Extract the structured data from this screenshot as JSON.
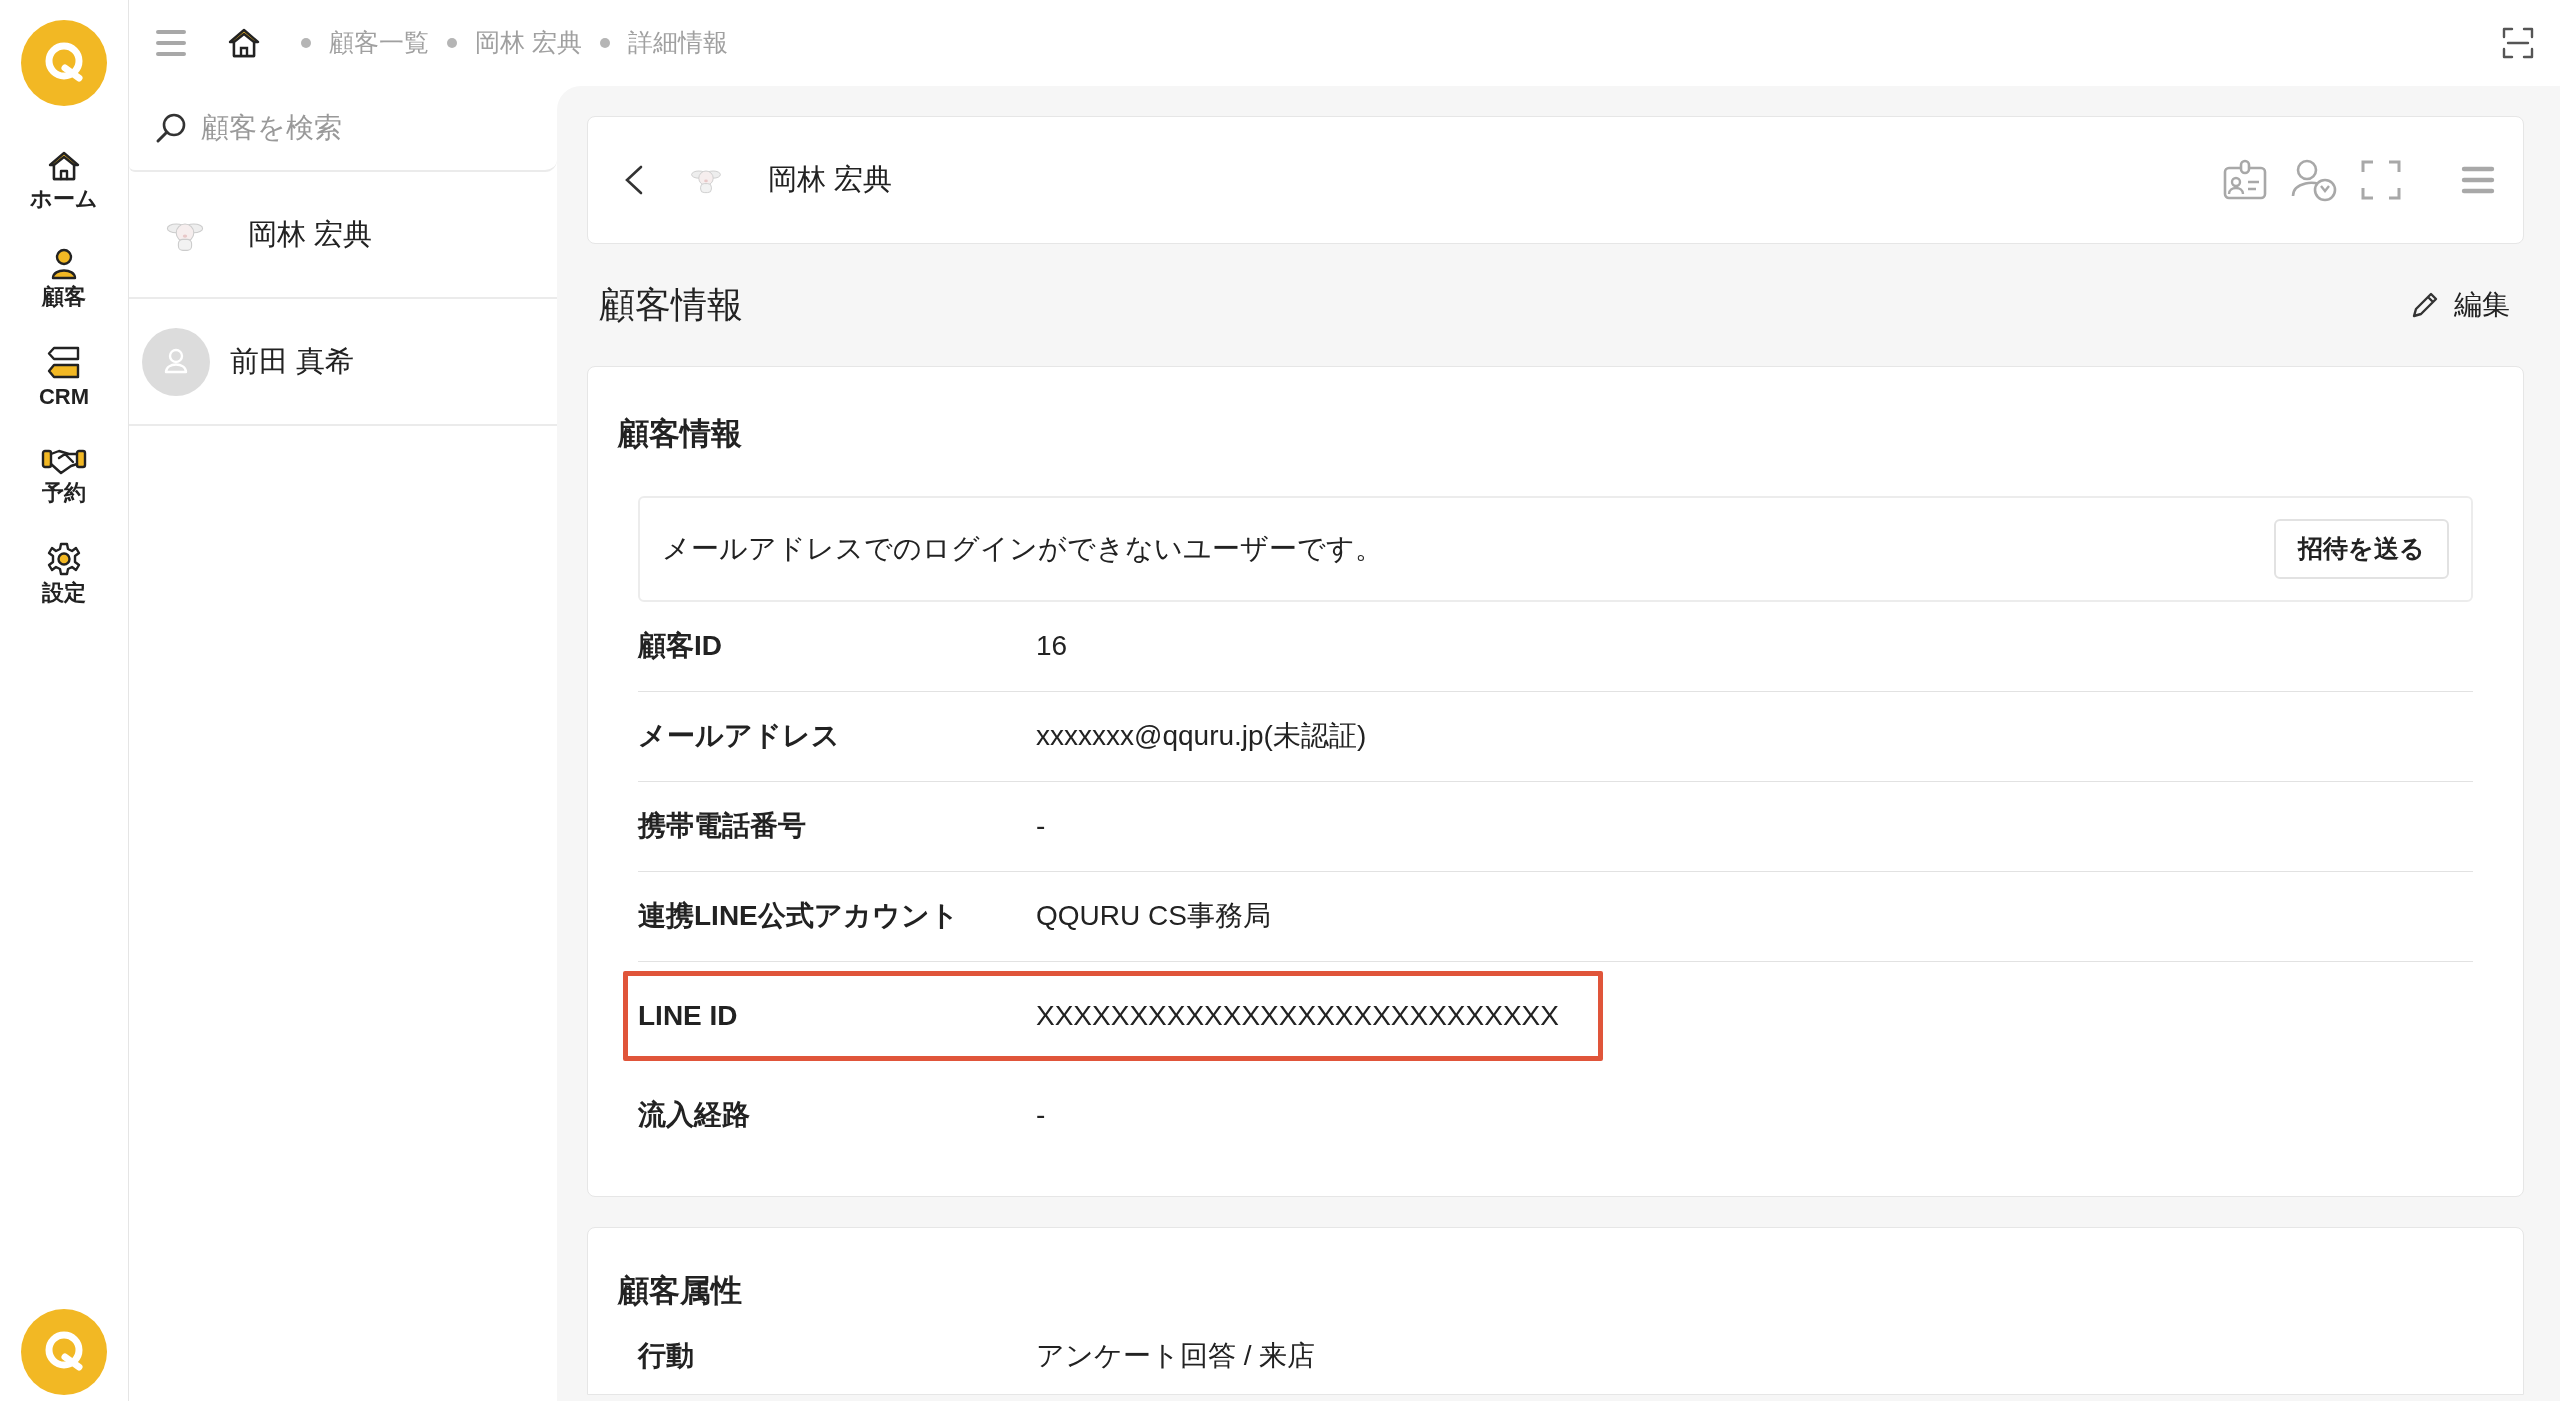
{
  "breadcrumb": [
    "顧客一覧",
    "岡林 宏典",
    "詳細情報"
  ],
  "nav": [
    {
      "label": "ホーム",
      "kind": "home"
    },
    {
      "label": "顧客",
      "kind": "customer"
    },
    {
      "label": "CRM",
      "kind": "crm"
    },
    {
      "label": "予約",
      "kind": "reservation"
    },
    {
      "label": "設定",
      "kind": "settings"
    }
  ],
  "search": {
    "placeholder": "顧客を検索"
  },
  "customers": [
    {
      "name": "岡林 宏典",
      "kind": "picture"
    },
    {
      "name": "前田 真希",
      "kind": "default"
    }
  ],
  "header": {
    "name": "岡林 宏典"
  },
  "section_title": "顧客情報",
  "edit": "編集",
  "info_card": {
    "title": "顧客情報",
    "notice": "メールアドレスでのログインができないユーザーです。",
    "invite_button": "招待を送る",
    "rows": [
      {
        "label": "顧客ID",
        "value": "16",
        "highlighted": false
      },
      {
        "label": "メールアドレス",
        "value": "xxxxxxx@qquru.jp(未認証)",
        "highlighted": false
      },
      {
        "label": "携帯電話番号",
        "value": "-",
        "highlighted": false
      },
      {
        "label": "連携LINE公式アカウント",
        "value": "QQURU CS事務局",
        "highlighted": false
      },
      {
        "label": "LINE ID",
        "value": "XXXXXXXXXXXXXXXXXXXXXXXXXXXX",
        "highlighted": true
      },
      {
        "label": "流入経路",
        "value": "-",
        "highlighted": false
      }
    ]
  },
  "attributes_card": {
    "title": "顧客属性",
    "rows": [
      {
        "label": "行動",
        "value": "アンケート回答 / 来店"
      }
    ]
  }
}
